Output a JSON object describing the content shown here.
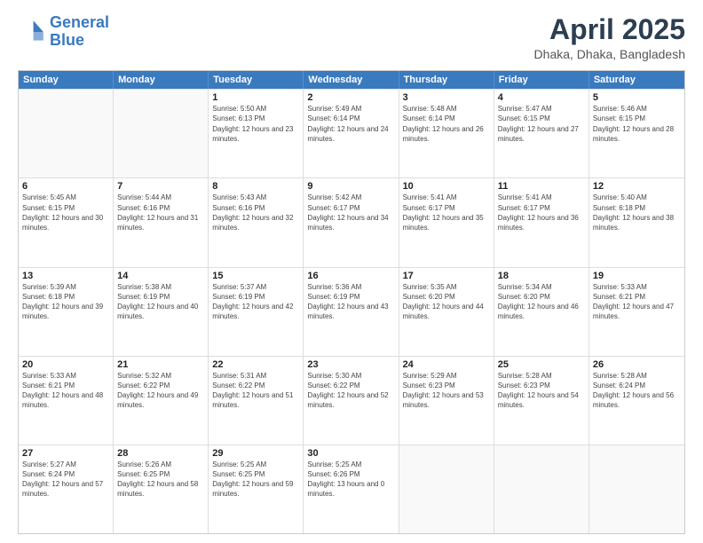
{
  "header": {
    "logo_line1": "General",
    "logo_line2": "Blue",
    "title": "April 2025",
    "subtitle": "Dhaka, Dhaka, Bangladesh"
  },
  "calendar": {
    "days_of_week": [
      "Sunday",
      "Monday",
      "Tuesday",
      "Wednesday",
      "Thursday",
      "Friday",
      "Saturday"
    ],
    "rows": [
      [
        {
          "day": "",
          "info": ""
        },
        {
          "day": "",
          "info": ""
        },
        {
          "day": "1",
          "info": "Sunrise: 5:50 AM\nSunset: 6:13 PM\nDaylight: 12 hours and 23 minutes."
        },
        {
          "day": "2",
          "info": "Sunrise: 5:49 AM\nSunset: 6:14 PM\nDaylight: 12 hours and 24 minutes."
        },
        {
          "day": "3",
          "info": "Sunrise: 5:48 AM\nSunset: 6:14 PM\nDaylight: 12 hours and 26 minutes."
        },
        {
          "day": "4",
          "info": "Sunrise: 5:47 AM\nSunset: 6:15 PM\nDaylight: 12 hours and 27 minutes."
        },
        {
          "day": "5",
          "info": "Sunrise: 5:46 AM\nSunset: 6:15 PM\nDaylight: 12 hours and 28 minutes."
        }
      ],
      [
        {
          "day": "6",
          "info": "Sunrise: 5:45 AM\nSunset: 6:15 PM\nDaylight: 12 hours and 30 minutes."
        },
        {
          "day": "7",
          "info": "Sunrise: 5:44 AM\nSunset: 6:16 PM\nDaylight: 12 hours and 31 minutes."
        },
        {
          "day": "8",
          "info": "Sunrise: 5:43 AM\nSunset: 6:16 PM\nDaylight: 12 hours and 32 minutes."
        },
        {
          "day": "9",
          "info": "Sunrise: 5:42 AM\nSunset: 6:17 PM\nDaylight: 12 hours and 34 minutes."
        },
        {
          "day": "10",
          "info": "Sunrise: 5:41 AM\nSunset: 6:17 PM\nDaylight: 12 hours and 35 minutes."
        },
        {
          "day": "11",
          "info": "Sunrise: 5:41 AM\nSunset: 6:17 PM\nDaylight: 12 hours and 36 minutes."
        },
        {
          "day": "12",
          "info": "Sunrise: 5:40 AM\nSunset: 6:18 PM\nDaylight: 12 hours and 38 minutes."
        }
      ],
      [
        {
          "day": "13",
          "info": "Sunrise: 5:39 AM\nSunset: 6:18 PM\nDaylight: 12 hours and 39 minutes."
        },
        {
          "day": "14",
          "info": "Sunrise: 5:38 AM\nSunset: 6:19 PM\nDaylight: 12 hours and 40 minutes."
        },
        {
          "day": "15",
          "info": "Sunrise: 5:37 AM\nSunset: 6:19 PM\nDaylight: 12 hours and 42 minutes."
        },
        {
          "day": "16",
          "info": "Sunrise: 5:36 AM\nSunset: 6:19 PM\nDaylight: 12 hours and 43 minutes."
        },
        {
          "day": "17",
          "info": "Sunrise: 5:35 AM\nSunset: 6:20 PM\nDaylight: 12 hours and 44 minutes."
        },
        {
          "day": "18",
          "info": "Sunrise: 5:34 AM\nSunset: 6:20 PM\nDaylight: 12 hours and 46 minutes."
        },
        {
          "day": "19",
          "info": "Sunrise: 5:33 AM\nSunset: 6:21 PM\nDaylight: 12 hours and 47 minutes."
        }
      ],
      [
        {
          "day": "20",
          "info": "Sunrise: 5:33 AM\nSunset: 6:21 PM\nDaylight: 12 hours and 48 minutes."
        },
        {
          "day": "21",
          "info": "Sunrise: 5:32 AM\nSunset: 6:22 PM\nDaylight: 12 hours and 49 minutes."
        },
        {
          "day": "22",
          "info": "Sunrise: 5:31 AM\nSunset: 6:22 PM\nDaylight: 12 hours and 51 minutes."
        },
        {
          "day": "23",
          "info": "Sunrise: 5:30 AM\nSunset: 6:22 PM\nDaylight: 12 hours and 52 minutes."
        },
        {
          "day": "24",
          "info": "Sunrise: 5:29 AM\nSunset: 6:23 PM\nDaylight: 12 hours and 53 minutes."
        },
        {
          "day": "25",
          "info": "Sunrise: 5:28 AM\nSunset: 6:23 PM\nDaylight: 12 hours and 54 minutes."
        },
        {
          "day": "26",
          "info": "Sunrise: 5:28 AM\nSunset: 6:24 PM\nDaylight: 12 hours and 56 minutes."
        }
      ],
      [
        {
          "day": "27",
          "info": "Sunrise: 5:27 AM\nSunset: 6:24 PM\nDaylight: 12 hours and 57 minutes."
        },
        {
          "day": "28",
          "info": "Sunrise: 5:26 AM\nSunset: 6:25 PM\nDaylight: 12 hours and 58 minutes."
        },
        {
          "day": "29",
          "info": "Sunrise: 5:25 AM\nSunset: 6:25 PM\nDaylight: 12 hours and 59 minutes."
        },
        {
          "day": "30",
          "info": "Sunrise: 5:25 AM\nSunset: 6:26 PM\nDaylight: 13 hours and 0 minutes."
        },
        {
          "day": "",
          "info": ""
        },
        {
          "day": "",
          "info": ""
        },
        {
          "day": "",
          "info": ""
        }
      ]
    ]
  }
}
